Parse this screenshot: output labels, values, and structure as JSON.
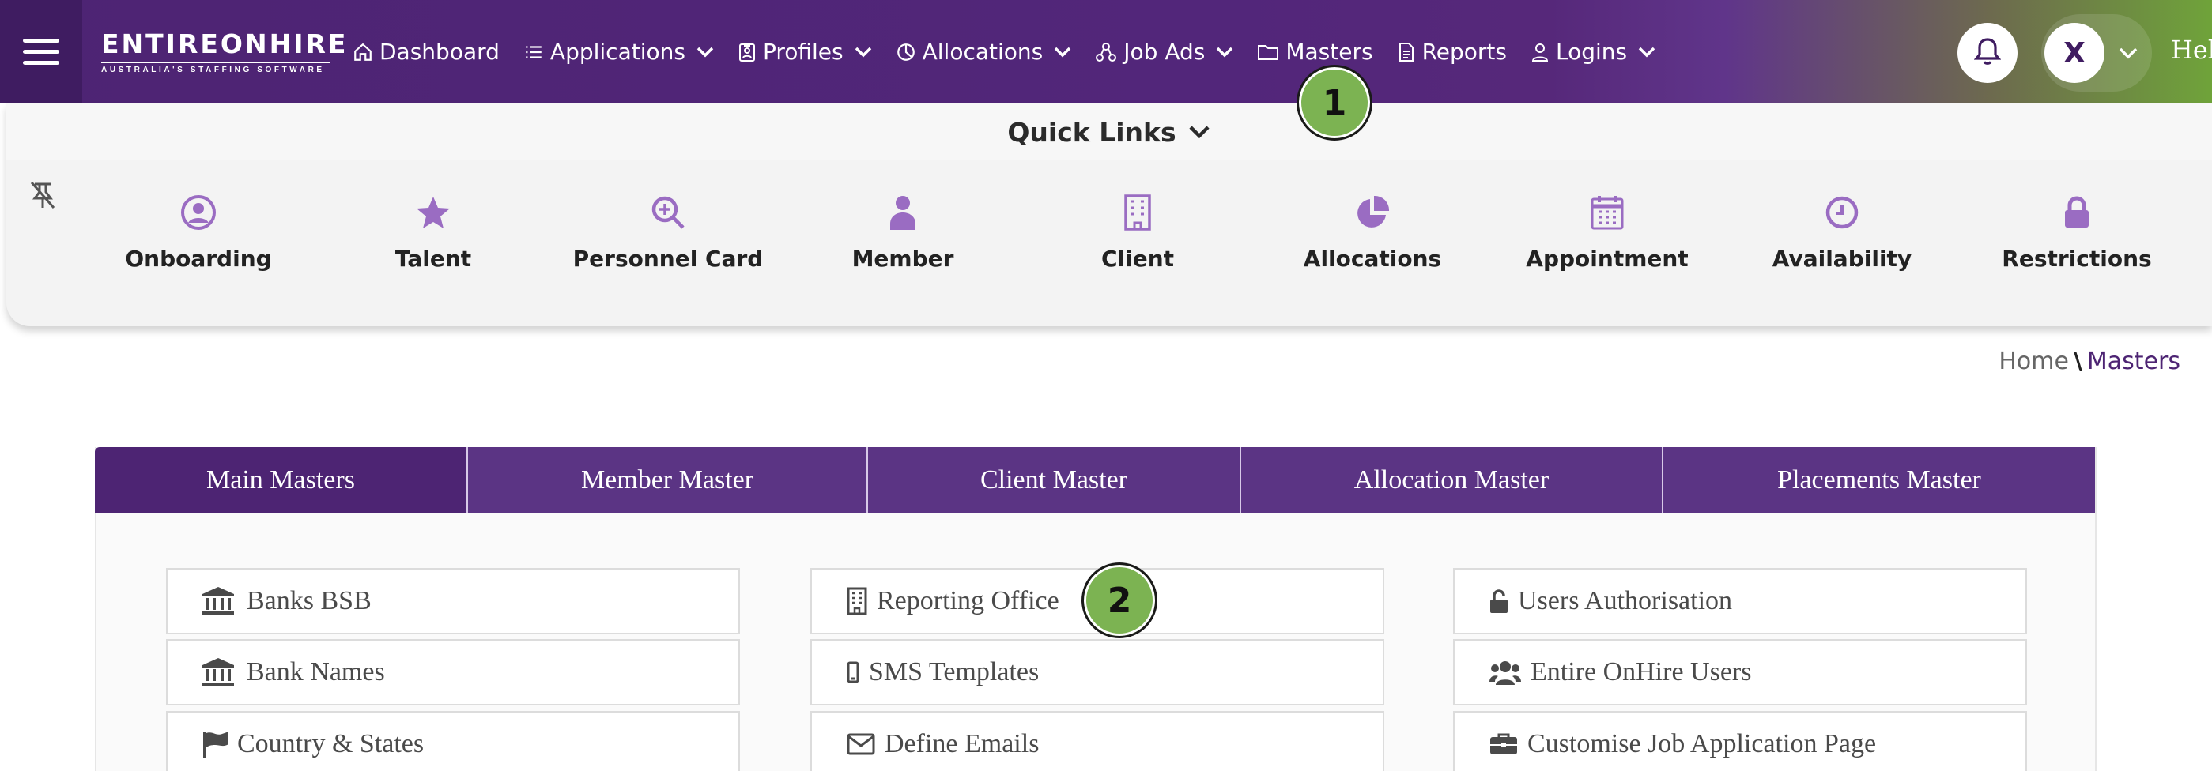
{
  "header": {
    "logo_main": "ENTIREONHIRE",
    "logo_sub": "AUSTRALIA'S STAFFING SOFTWARE",
    "nav": [
      {
        "label": "Dashboard",
        "icon": "home-icon",
        "dropdown": false
      },
      {
        "label": "Applications",
        "icon": "list-icon",
        "dropdown": true
      },
      {
        "label": "Profiles",
        "icon": "id-badge-icon",
        "dropdown": true
      },
      {
        "label": "Allocations",
        "icon": "pie-chart-icon",
        "dropdown": true
      },
      {
        "label": "Job Ads",
        "icon": "network-icon",
        "dropdown": true
      },
      {
        "label": "Masters",
        "icon": "folder-icon",
        "dropdown": false
      },
      {
        "label": "Reports",
        "icon": "document-icon",
        "dropdown": false
      },
      {
        "label": "Logins",
        "icon": "user-icon",
        "dropdown": true
      }
    ],
    "avatar_letter": "X",
    "greeting": "Hel"
  },
  "markers": {
    "step1": "1",
    "step2": "2"
  },
  "quick_links": {
    "title": "Quick Links",
    "items": [
      {
        "label": "Onboarding",
        "icon": "user-circle-icon"
      },
      {
        "label": "Talent",
        "icon": "star-icon"
      },
      {
        "label": "Personnel Card",
        "icon": "search-plus-icon"
      },
      {
        "label": "Member",
        "icon": "person-icon"
      },
      {
        "label": "Client",
        "icon": "building-icon"
      },
      {
        "label": "Allocations",
        "icon": "pie-chart-icon"
      },
      {
        "label": "Appointment",
        "icon": "calendar-icon"
      },
      {
        "label": "Availability",
        "icon": "clock-icon"
      },
      {
        "label": "Restrictions",
        "icon": "lock-icon"
      }
    ]
  },
  "breadcrumb": {
    "home": "Home",
    "separator": "\\",
    "current": "Masters"
  },
  "tabs": [
    {
      "label": "Main Masters",
      "active": true
    },
    {
      "label": "Member Master",
      "active": false
    },
    {
      "label": "Client Master",
      "active": false
    },
    {
      "label": "Allocation Master",
      "active": false
    },
    {
      "label": "Placements Master",
      "active": false
    }
  ],
  "tiles": {
    "col1": [
      {
        "label": "Banks BSB",
        "icon": "bank-icon"
      },
      {
        "label": "Bank Names",
        "icon": "bank-icon"
      },
      {
        "label": "Country & States",
        "icon": "flag-icon"
      }
    ],
    "col2": [
      {
        "label": "Reporting Office",
        "icon": "building-icon"
      },
      {
        "label": "SMS Templates",
        "icon": "mobile-icon"
      },
      {
        "label": "Define Emails",
        "icon": "envelope-icon"
      }
    ],
    "col3": [
      {
        "label": "Users Authorisation",
        "icon": "unlock-icon"
      },
      {
        "label": "Entire OnHire Users",
        "icon": "users-icon"
      },
      {
        "label": "Customise Job Application Page",
        "icon": "briefcase-icon"
      }
    ]
  },
  "colors": {
    "brand_purple": "#4d2473",
    "tab_purple": "#5b3484",
    "accent_green": "#7cb352",
    "icon_lavender": "#9a6cc2"
  }
}
